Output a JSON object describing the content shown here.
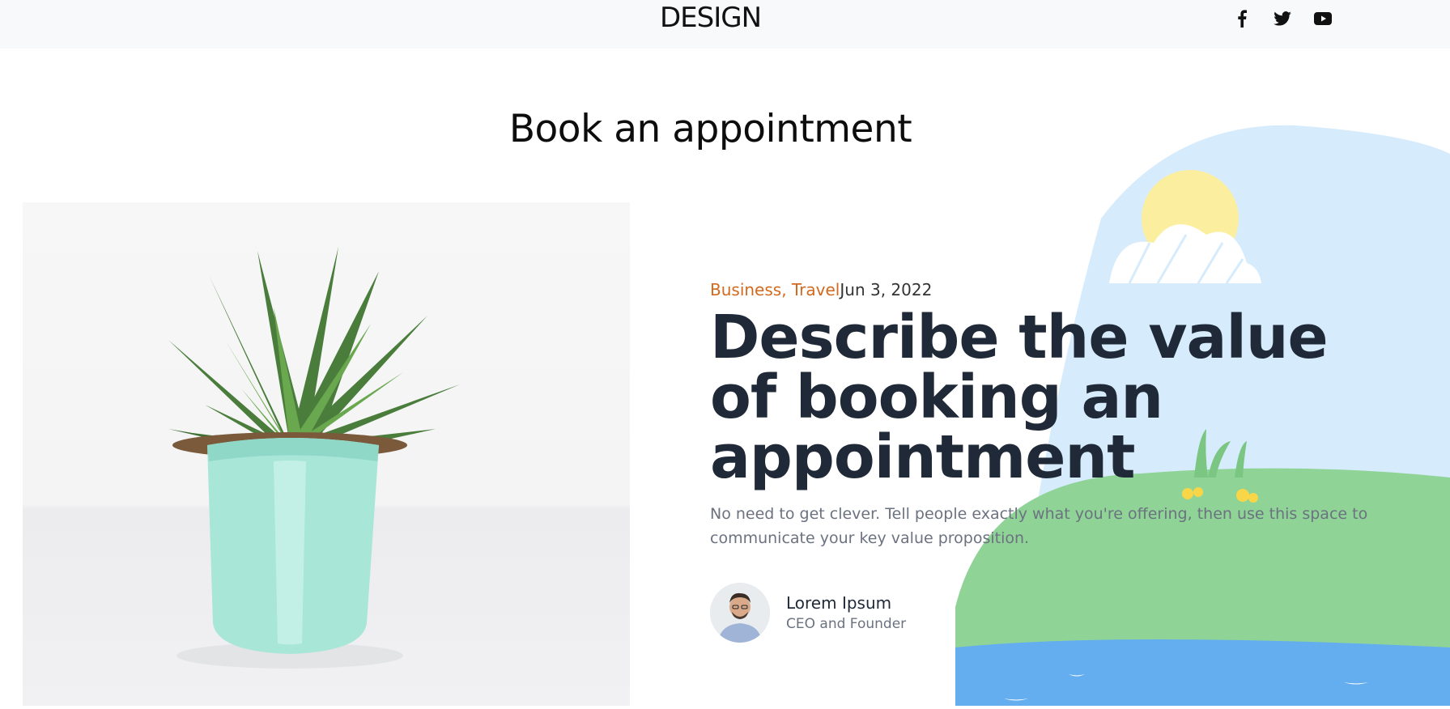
{
  "header": {
    "logo": "DESIGN",
    "social": [
      {
        "name": "facebook-icon"
      },
      {
        "name": "twitter-icon"
      },
      {
        "name": "youtube-icon"
      }
    ]
  },
  "page": {
    "heading": "Book an appointment"
  },
  "article": {
    "categories": "Business, Travel",
    "date": "Jun 3, 2022",
    "title": "Describe the value of booking an appointment",
    "description": "No need to get clever. Tell people exactly what you're offering, then use this space to communicate your key value proposition."
  },
  "author": {
    "name": "Lorem Ipsum",
    "role": "CEO and Founder"
  },
  "colors": {
    "accent": "#d2691e",
    "title": "#1f2937",
    "sky": "#d6ebfb",
    "grass": "#8fd496",
    "water": "#64aef0",
    "sun": "#fbef9f"
  }
}
